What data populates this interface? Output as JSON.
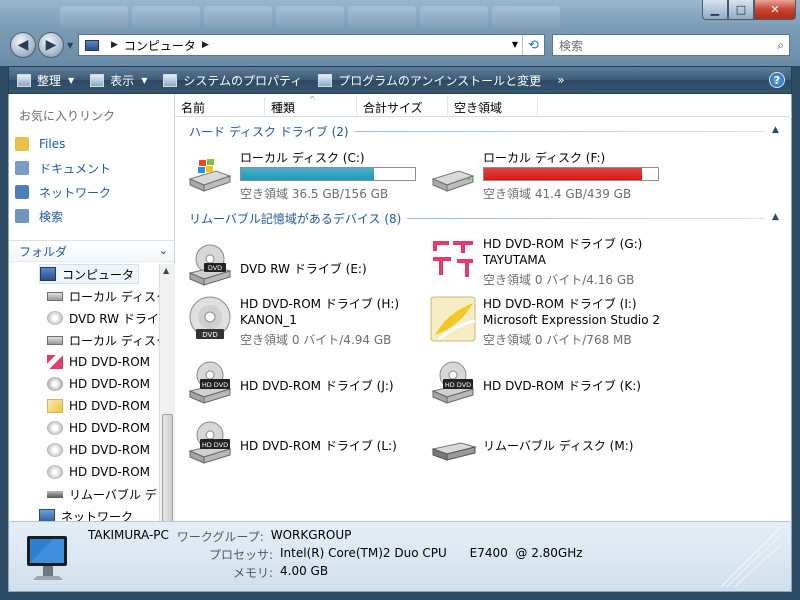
{
  "address": {
    "segment": "コンピュータ"
  },
  "search": {
    "placeholder": "検索"
  },
  "toolbar": {
    "organize": "整理",
    "views": "表示",
    "system_properties": "システムのプロパティ",
    "uninstall": "プログラムのアンインストールと変更",
    "more": "»"
  },
  "favorites": {
    "title": "お気に入りリンク",
    "items": [
      {
        "label": "Files",
        "icon": "folder-icon",
        "color": "#e8c04a"
      },
      {
        "label": "ドキュメント",
        "icon": "documents-icon",
        "color": "#7a9cc4"
      },
      {
        "label": "ネットワーク",
        "icon": "network-icon",
        "color": "#4f7fb5"
      },
      {
        "label": "検索",
        "icon": "search-folder-icon",
        "color": "#6f95bd"
      }
    ]
  },
  "folders": {
    "title": "フォルダ",
    "items": [
      {
        "label": "コンピュータ",
        "icon": "computer-icon",
        "level": 0
      },
      {
        "label": "ローカル ディスク",
        "icon": "hard-drive-icon",
        "level": 1
      },
      {
        "label": "DVD RW ドライブ",
        "icon": "dvd-drive-icon",
        "level": 1
      },
      {
        "label": "ローカル ディスク",
        "icon": "hard-drive-icon",
        "level": 1
      },
      {
        "label": "HD DVD-ROM",
        "icon": "tayutama-icon",
        "level": 1
      },
      {
        "label": "HD DVD-ROM",
        "icon": "disc-icon",
        "level": 1
      },
      {
        "label": "HD DVD-ROM",
        "icon": "expression-icon",
        "level": 1
      },
      {
        "label": "HD DVD-ROM",
        "icon": "hd-dvd-drive-icon",
        "level": 1
      },
      {
        "label": "HD DVD-ROM",
        "icon": "hd-dvd-drive-icon",
        "level": 1
      },
      {
        "label": "HD DVD-ROM",
        "icon": "hd-dvd-drive-icon",
        "level": 1
      },
      {
        "label": "リムーバブル デ",
        "icon": "removable-disk-icon",
        "level": 1
      },
      {
        "label": "ネットワーク",
        "icon": "network-icon",
        "level": 0
      }
    ]
  },
  "columns": [
    "名前",
    "種類",
    "合計サイズ",
    "空き領域"
  ],
  "groups": {
    "hdd": "ハード ディスク ドライブ (2)",
    "removable": "リムーバブル記憶域があるデバイス (8)"
  },
  "drives": {
    "c": {
      "name": "ローカル ディスク (C:)",
      "free": "空き領域 36.5 GB/156 GB",
      "used_fraction": 0.766,
      "bar_color": "#1e9bb8"
    },
    "f": {
      "name": "ローカル ディスク (F:)",
      "free": "空き領域 41.4 GB/439 GB",
      "used_fraction": 0.906,
      "bar_color": "#d81818"
    }
  },
  "devices": {
    "e": {
      "name": "DVD RW ドライブ (E:)"
    },
    "g": {
      "name": "HD DVD-ROM ドライブ (G:)",
      "label": "TAYUTAMA",
      "free": "空き領域 0 バイト/4.16 GB"
    },
    "h": {
      "name": "HD DVD-ROM ドライブ (H:)",
      "label": "KANON_1",
      "free": "空き領域 0 バイト/4.94 GB"
    },
    "i": {
      "name": "HD DVD-ROM ドライブ (I:)",
      "label": "Microsoft Expression Studio 2",
      "free": "空き領域 0 バイト/768 MB"
    },
    "j": {
      "name": "HD DVD-ROM ドライブ (J:)"
    },
    "k": {
      "name": "HD DVD-ROM ドライブ (K:)"
    },
    "l": {
      "name": "HD DVD-ROM ドライブ (L:)"
    },
    "m": {
      "name": "リムーバブル ディスク (M:)"
    }
  },
  "details": {
    "computer_name": "TAKIMURA-PC",
    "workgroup_label": "ワークグループ:",
    "workgroup": "WORKGROUP",
    "processor_label": "プロセッサ:",
    "processor": "Intel(R) Core(TM)2 Duo CPU      E7400  @ 2.80GHz",
    "memory_label": "メモリ:",
    "memory": "4.00 GB"
  }
}
